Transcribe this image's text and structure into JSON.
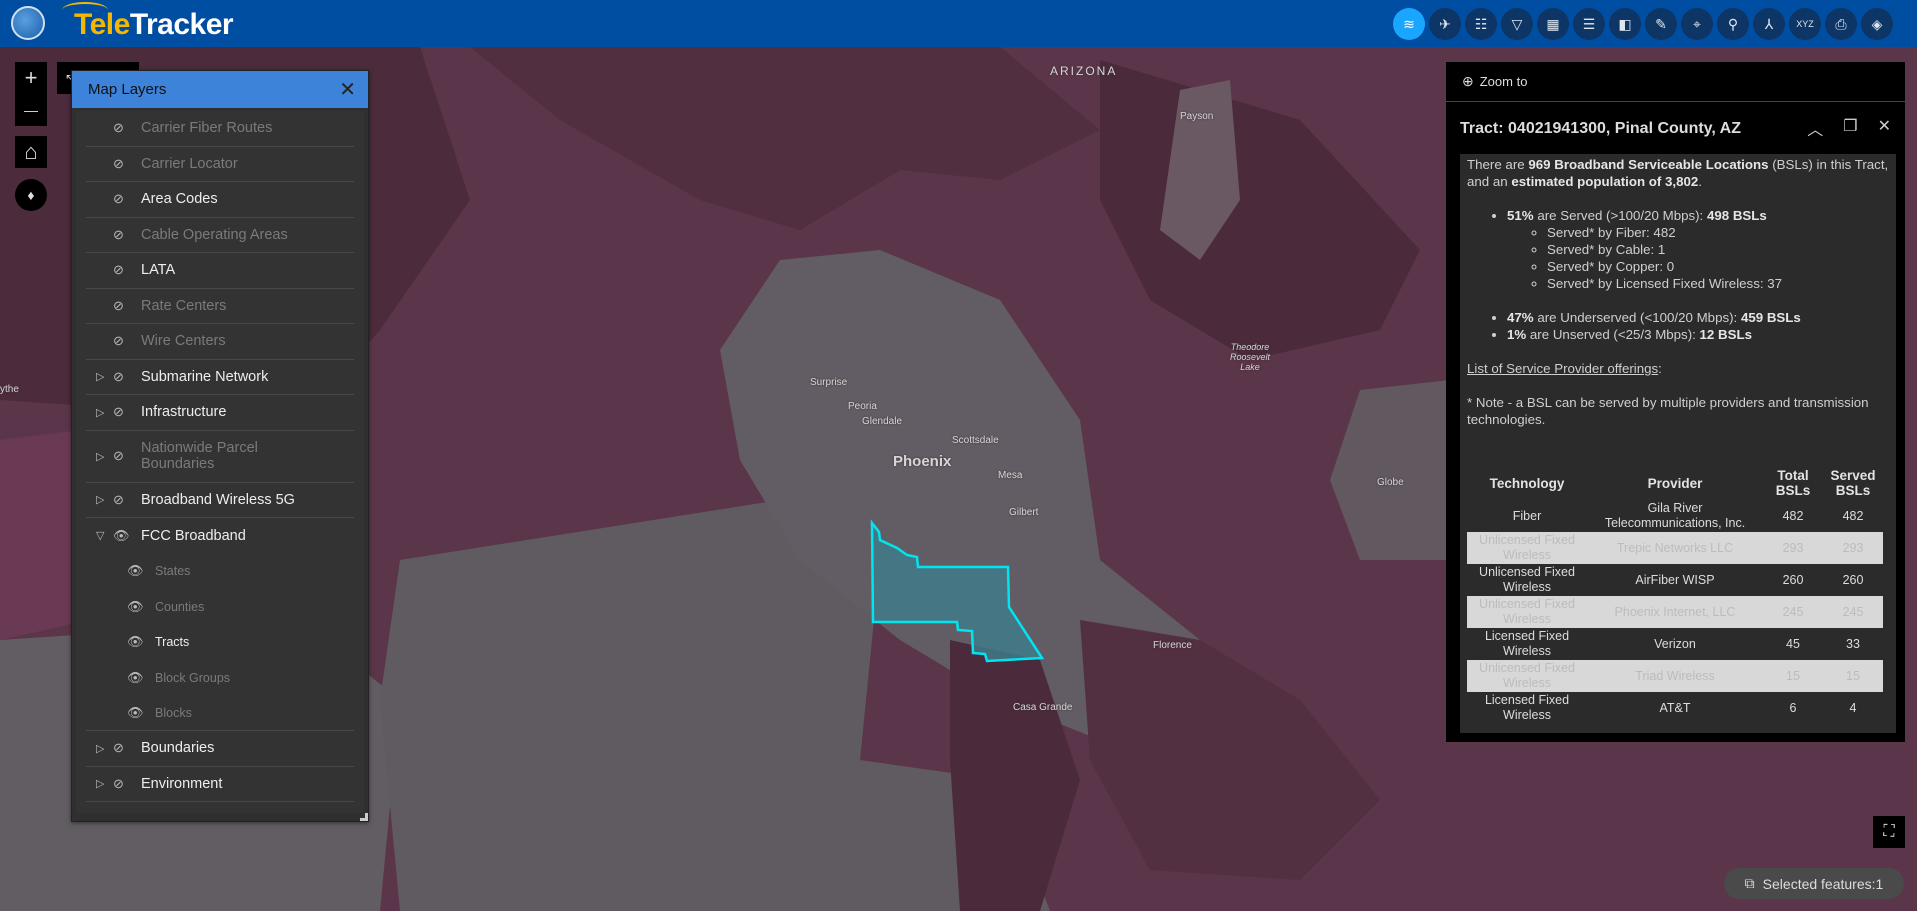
{
  "app": {
    "title_part1": "Tele",
    "title_part2": "Tracker"
  },
  "toolbar": [
    {
      "icon": "layers-icon",
      "glyph": "≋",
      "active": true
    },
    {
      "icon": "gps-tracking-icon",
      "glyph": "✈"
    },
    {
      "icon": "query-icon",
      "glyph": "☷"
    },
    {
      "icon": "filter-icon",
      "glyph": "▽"
    },
    {
      "icon": "table-icon",
      "glyph": "▦"
    },
    {
      "icon": "legend-list-icon",
      "glyph": "☰"
    },
    {
      "icon": "bookmark-icon",
      "glyph": "◧"
    },
    {
      "icon": "draw-palette-icon",
      "glyph": "✎"
    },
    {
      "icon": "location-pin-icon",
      "glyph": "⌖"
    },
    {
      "icon": "search-icon",
      "glyph": "⚲"
    },
    {
      "icon": "coordinate-axes-icon",
      "glyph": "⅄"
    },
    {
      "icon": "xyz-coordinate-icon",
      "glyph": "XYZ"
    },
    {
      "icon": "print-icon",
      "glyph": "⎙"
    },
    {
      "icon": "directions-icon",
      "glyph": "◈"
    }
  ],
  "map_controls": {
    "zoom_in": "+",
    "zoom_out": "—",
    "home": "⌂",
    "compass": "♦",
    "fullscreen": "⛶"
  },
  "layers_panel": {
    "title": "Map Layers",
    "items": [
      {
        "label": "Carrier Fiber Routes",
        "dim": true,
        "expand": ""
      },
      {
        "label": "Carrier Locator",
        "dim": true,
        "expand": ""
      },
      {
        "label": "Area Codes",
        "dim": false,
        "expand": ""
      },
      {
        "label": "Cable Operating Areas",
        "dim": true,
        "expand": ""
      },
      {
        "label": "LATA",
        "dim": false,
        "expand": ""
      },
      {
        "label": "Rate Centers",
        "dim": true,
        "expand": ""
      },
      {
        "label": "Wire Centers",
        "dim": true,
        "expand": ""
      },
      {
        "label": "Submarine Network",
        "dim": false,
        "expand": "▷"
      },
      {
        "label": "Infrastructure",
        "dim": false,
        "expand": "▷"
      },
      {
        "label": "Nationwide Parcel Boundaries",
        "dim": true,
        "expand": "▷"
      },
      {
        "label": "Broadband Wireless 5G",
        "dim": false,
        "expand": "▷"
      },
      {
        "label": "FCC Broadband",
        "dim": false,
        "expand": "▽",
        "visible": true
      },
      {
        "label": "States",
        "dim": true,
        "sub": true
      },
      {
        "label": "Counties",
        "dim": true,
        "sub": true
      },
      {
        "label": "Tracts",
        "dim": false,
        "sub": true
      },
      {
        "label": "Block Groups",
        "dim": true,
        "sub": true
      },
      {
        "label": "Blocks",
        "dim": true,
        "sub": true
      },
      {
        "label": "Boundaries",
        "dim": false,
        "expand": "▷"
      },
      {
        "label": "Environment",
        "dim": false,
        "expand": "▷"
      }
    ]
  },
  "popup": {
    "zoom_to": "Zoom to",
    "title": "Tract: 04021941300, Pinal County, AZ",
    "intro": {
      "t1": "There are ",
      "b1": "969 Broadband Serviceable Locations",
      "t2": " (BSLs) in this Tract, and an ",
      "b2": "estimated population of 3,802",
      "t3": "."
    },
    "served": {
      "pct": "51%",
      "text": " are Served (>100/20 Mbps): ",
      "count": "498 BSLs"
    },
    "served_by": [
      "Served* by Fiber: 482",
      "Served* by Cable: 1",
      "Served* by Copper: 0",
      "Served* by Licensed Fixed Wireless: 37"
    ],
    "underserved": {
      "pct": "47%",
      "text": " are Underserved (<100/20 Mbps): ",
      "count": "459 BSLs"
    },
    "unserved": {
      "pct": "1%",
      "text": " are Unserved (<25/3 Mbps): ",
      "count": "12 BSLs"
    },
    "provider_link": "List of Service Provider offerings",
    "note": "* Note - a BSL can be served by multiple providers and transmission technologies.",
    "table": {
      "headers": [
        "Technology",
        "Provider",
        "Total BSLs",
        "Served BSLs"
      ],
      "rows": [
        [
          "Fiber",
          "Gila River Telecommunications, Inc.",
          "482",
          "482"
        ],
        [
          "Unlicensed Fixed Wireless",
          "Trepic Networks LLC",
          "293",
          "293"
        ],
        [
          "Unlicensed Fixed Wireless",
          "AirFiber WISP",
          "260",
          "260"
        ],
        [
          "Unlicensed Fixed Wireless",
          "Phoenix Internet, LLC",
          "245",
          "245"
        ],
        [
          "Licensed Fixed Wireless",
          "Verizon",
          "45",
          "33"
        ],
        [
          "Unlicensed Fixed Wireless",
          "Triad Wireless",
          "15",
          "15"
        ],
        [
          "Licensed Fixed Wireless",
          "AT&T",
          "6",
          "4"
        ]
      ]
    }
  },
  "map_labels": [
    "ARIZONA",
    "Payson",
    "Theodore Roosevelt Lake",
    "Globe",
    "Surprise",
    "Peoria",
    "Glendale",
    "Scottsdale",
    "Phoenix",
    "Mesa",
    "Gilbert",
    "Florence",
    "Casa Grande",
    "ythe"
  ],
  "selected_features": "Selected features:1",
  "colors": {
    "header": "#004ea2",
    "active_tool": "#1aa6ff",
    "panel_header": "#3d83d9",
    "selection": "#00e5f0"
  }
}
